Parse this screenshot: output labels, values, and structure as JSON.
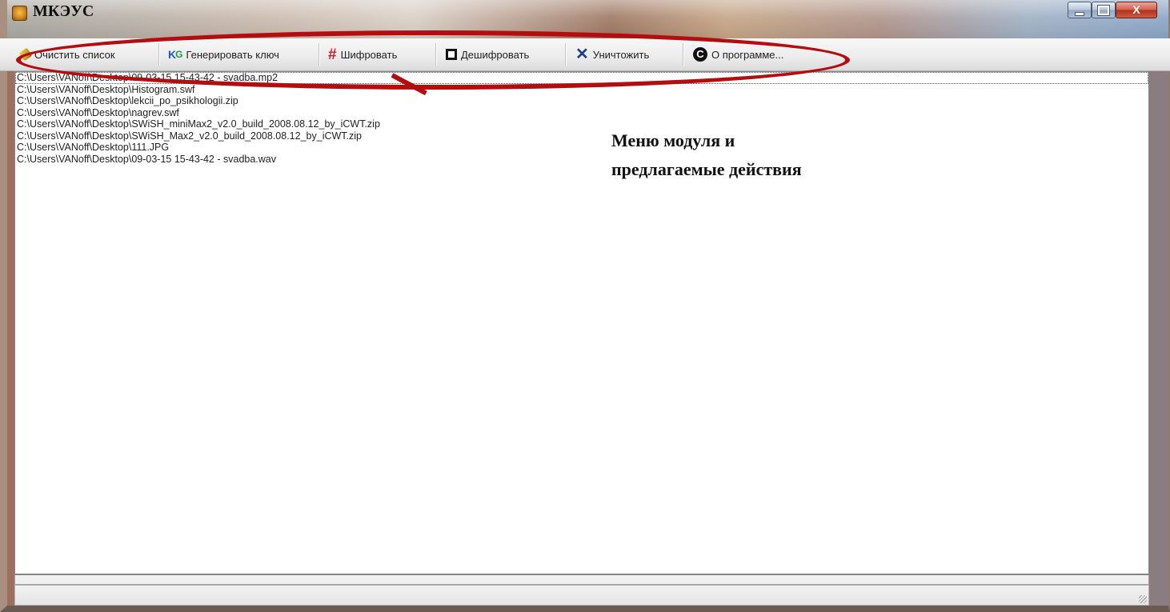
{
  "window": {
    "title": "МКЭУС",
    "controls": {
      "minimize": "",
      "maximize": "",
      "close": "X"
    }
  },
  "toolbar": {
    "items": [
      {
        "label": "Очистить список",
        "icon": "eraser-icon"
      },
      {
        "label": "Генерировать ключ",
        "icon": "key-generate-icon",
        "icon_text": "K",
        "icon_sub": "G"
      },
      {
        "label": "Шифровать",
        "icon": "encrypt-icon",
        "icon_text": "#"
      },
      {
        "label": "Дешифровать",
        "icon": "decrypt-icon"
      },
      {
        "label": "Уничтожить",
        "icon": "destroy-icon",
        "icon_text": "✕"
      },
      {
        "label": "О программе...",
        "icon": "copyright-icon",
        "icon_text": "C"
      }
    ]
  },
  "file_list": [
    "C:\\Users\\VANoff\\Desktop\\09-03-15 15-43-42 - svadba.mp2",
    "C:\\Users\\VANoff\\Desktop\\Histogram.swf",
    "C:\\Users\\VANoff\\Desktop\\lekcii_po_psikhologii.zip",
    "C:\\Users\\VANoff\\Desktop\\nagrev.swf",
    "C:\\Users\\VANoff\\Desktop\\SWiSH_miniMax2_v2.0_build_2008.08.12_by_iCWT.zip",
    "C:\\Users\\VANoff\\Desktop\\SWiSH_Max2_v2.0_build_2008.08.12_by_iCWT.zip",
    "C:\\Users\\VANoff\\Desktop\\111.JPG",
    "C:\\Users\\VANoff\\Desktop\\09-03-15 15-43-42 - svadba.wav"
  ],
  "annotation": {
    "line1": "Меню модуля и",
    "line2": "предлагаемые действия",
    "color": "#b30d10"
  }
}
